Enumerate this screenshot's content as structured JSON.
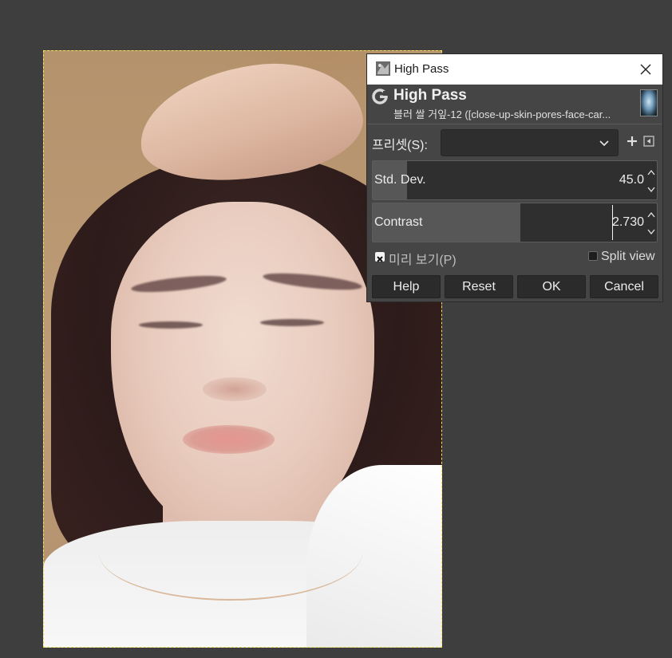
{
  "window": {
    "title": "High Pass",
    "close_label": "×"
  },
  "header": {
    "title": "High Pass",
    "subtitle": "블러 쌀 거잎-12 ([close-up-skin-pores-face-car..."
  },
  "presets": {
    "label": "프리셋(S):",
    "value": ""
  },
  "std_dev": {
    "label": "Std. Dev.",
    "value": "45.0",
    "fill_fraction": 0.12
  },
  "contrast": {
    "label": "Contrast",
    "value": "2.730",
    "fill_fraction": 0.52
  },
  "preview": {
    "label": "미리 보기(P)",
    "checked": true
  },
  "split_view": {
    "label": "Split view",
    "checked": false
  },
  "buttons": {
    "help": "Help",
    "reset": "Reset",
    "ok": "OK",
    "cancel": "Cancel"
  }
}
